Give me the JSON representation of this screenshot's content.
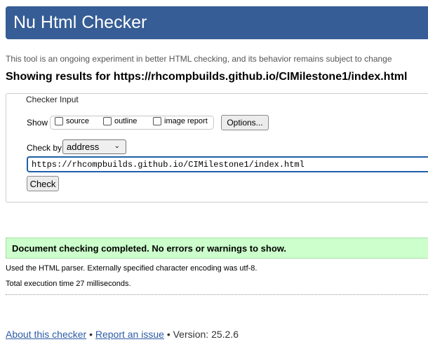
{
  "header": {
    "title": "Nu Html Checker"
  },
  "subtitle": "This tool is an ongoing experiment in better HTML checking, and its behavior remains subject to change",
  "results_heading": "Showing results for https://rhcompbuilds.github.io/CIMilestone1/index.html",
  "checker_input": {
    "legend": "Checker Input",
    "show_label": "Show",
    "options": [
      {
        "label": "source",
        "checked": false
      },
      {
        "label": "outline",
        "checked": false
      },
      {
        "label": "image report",
        "checked": false
      }
    ],
    "options_button": "Options...",
    "check_by_label": "Check by",
    "check_by_value": "address",
    "url_value": "https://rhcompbuilds.github.io/CIMilestone1/index.html",
    "check_button": "Check"
  },
  "result": {
    "message": "Document checking completed. No errors or warnings to show.",
    "parser_info": "Used the HTML parser. Externally specified character encoding was utf-8.",
    "execution_time": "Total execution time 27 milliseconds."
  },
  "footer": {
    "about_link": "About this checker",
    "separator": "•",
    "report_link": "Report an issue",
    "version": "Version: 25.2.6"
  },
  "colors": {
    "banner": "#365d95",
    "success_bg": "#ccffcc",
    "link": "#2e5ca6",
    "input_focus": "#1f5fa8"
  }
}
